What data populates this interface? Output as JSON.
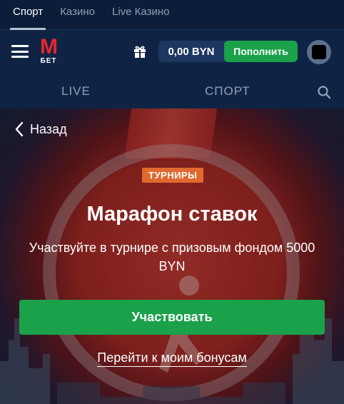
{
  "top_tabs": [
    "Спорт",
    "Казино",
    "Live Казино"
  ],
  "header": {
    "logo_letter": "M",
    "logo_sub": "БЕТ",
    "balance": "0,00 BYN",
    "topup_label": "Пополнить"
  },
  "sub_nav": {
    "live": "LIVE",
    "sport": "СПОРТ"
  },
  "hero": {
    "back_label": "Назад",
    "badge": "ТУРНИРЫ",
    "title": "Марафон ставок",
    "subtitle": "Участвуйте в турнире с призовым фондом 5000 BYN",
    "cta_label": "Участвовать",
    "bonus_link": "Перейти к моим бонусам"
  },
  "colors": {
    "accent_green": "#1aa14a",
    "badge_orange": "#e06a2e",
    "header_bg": "#0f2445",
    "brand_red": "#e8262c"
  },
  "icons": [
    "menu-icon",
    "gift-icon",
    "avatar",
    "search-icon",
    "chevron-left-icon"
  ]
}
